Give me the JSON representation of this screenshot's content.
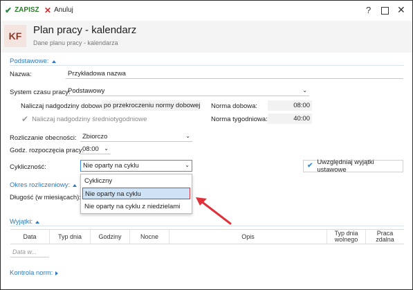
{
  "toolbar": {
    "save_label": "ZAPISZ",
    "cancel_label": "Anuluj",
    "help_label": "?",
    "close_label": "✕"
  },
  "header": {
    "avatar": "KF",
    "title": "Plan pracy - kalendarz",
    "subtitle": "Dane planu pracy - kalendarza"
  },
  "sections": {
    "basic": "Podstawowe:",
    "period": "Okres rozliczeniowy:",
    "exceptions": "Wyjątki:",
    "norm_control": "Kontrola norm:"
  },
  "form": {
    "name_label": "Nazwa:",
    "name_value": "Przykładowa nazwa",
    "system_label": "System czasu pracy:",
    "system_value": "Podstawowy",
    "overtime_daily_label": "Naliczaj nadgodziny dobowe:",
    "overtime_daily_value": "po przekroczeniu normy dobowej",
    "norm_daily_label": "Norma dobowa:",
    "norm_daily_value": "08:00",
    "overtime_weekly_label": "Naliczaj nadgodziny średniotygodniowe",
    "norm_weekly_label": "Norma tygodniowa:",
    "norm_weekly_value": "40:00",
    "attendance_label": "Rozliczanie obecności:",
    "attendance_value": "Zbiorczo",
    "start_time_label": "Godz. rozpoczęcia pracy:",
    "start_time_value": "08:00",
    "cyclic_label": "Cykliczność:",
    "cyclic_value": "Nie oparty na cyklu",
    "exceptions_button": "Uwzględniaj wyjątki ustawowe",
    "length_label": "Długość (w miesiącach):"
  },
  "dropdown": {
    "options": [
      "Cykliczny",
      "Nie oparty na cyklu",
      "Nie oparty na cyklu z niedzielami"
    ],
    "selected_index": 1
  },
  "table": {
    "columns": [
      "Data",
      "Typ dnia",
      "Godziny",
      "Nocne",
      "Opis",
      "Typ dnia wolnego",
      "Praca zdalna"
    ],
    "filter_placeholder": "Data w..."
  },
  "colors": {
    "accent": "#2b79c2",
    "save": "#1f8a3a",
    "cancel": "#d42a2a",
    "highlight": "#e0303a"
  }
}
